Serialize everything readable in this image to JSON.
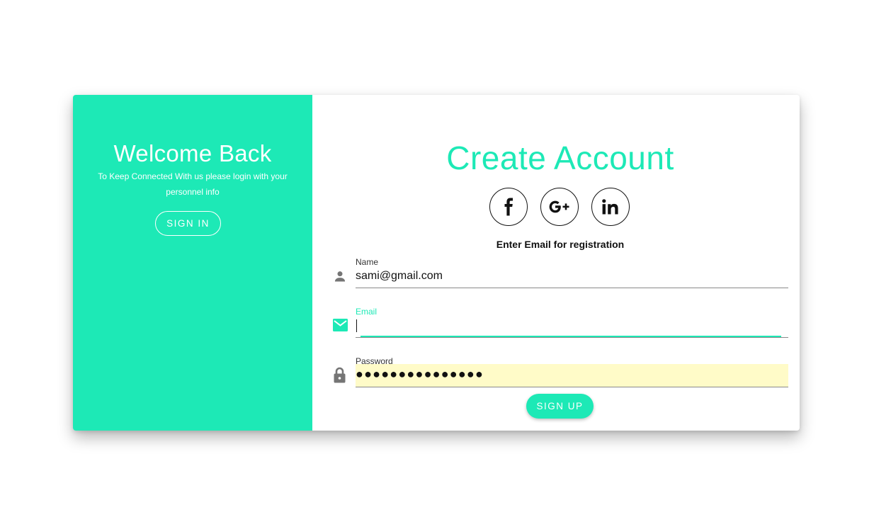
{
  "left": {
    "title": "Welcome Back",
    "subtitle_line1": "To Keep Connected With us please login with your",
    "subtitle_line2": "personnel info",
    "signin_label": "SIGN IN"
  },
  "right": {
    "title": "Create Account",
    "social": [
      {
        "name": "facebook",
        "glyph": "f"
      },
      {
        "name": "google-plus",
        "glyph": "G+"
      },
      {
        "name": "linkedin",
        "glyph": "in"
      }
    ],
    "registration_label": "Enter Email for registration",
    "fields": {
      "name": {
        "label": "Name",
        "value": "sami@gmail.com",
        "icon": "person-icon"
      },
      "email": {
        "label": "Email",
        "value": "",
        "icon": "mail-icon"
      },
      "password": {
        "label": "Password",
        "value": "●●●●●●●●●●●●●●●",
        "icon": "lock-icon"
      }
    },
    "signup_label": "SIGN UP"
  },
  "colors": {
    "accent": "#1de9b6",
    "autofill": "#fffbc8"
  }
}
